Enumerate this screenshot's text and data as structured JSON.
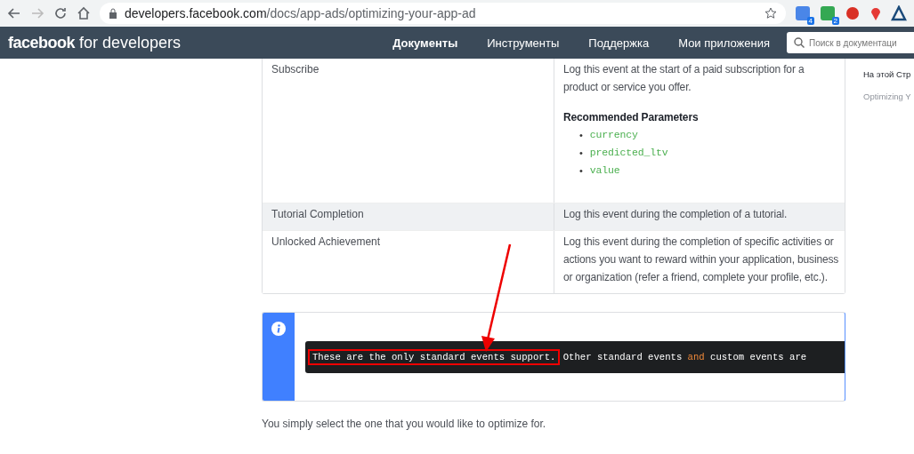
{
  "browser": {
    "url_host": "developers.facebook.com",
    "url_path": "/docs/app-ads/optimizing-your-app-ad",
    "extension_badges": [
      "4",
      "2"
    ]
  },
  "nav": {
    "logo_bold": "facebook",
    "logo_rest": "for developers",
    "links": [
      {
        "label": "Документы",
        "selected": true
      },
      {
        "label": "Инструменты",
        "selected": false
      },
      {
        "label": "Поддержка",
        "selected": false
      },
      {
        "label": "Мои приложения",
        "selected": false
      }
    ],
    "search": {
      "placeholder": "Поиск в документаци"
    }
  },
  "table": {
    "rows": [
      {
        "event": "Subscribe",
        "description": "Log this event at the start of a paid subscription for a product or service you offer.",
        "params_title": "Recommended Parameters",
        "params": [
          {
            "marker": "•",
            "name": "currency"
          },
          {
            "marker": "•",
            "name": "predicted_ltv"
          },
          {
            "marker": "•",
            "name": "value"
          }
        ],
        "shaded": false
      },
      {
        "event": "Tutorial Completion",
        "description": "Log this event during the completion of a tutorial.",
        "shaded": true
      },
      {
        "event": "Unlocked Achievement",
        "description": "Log this event during the completion of specific activities or actions you want to reward within your application, business or organization (refer a friend, complete your profile, etc.).",
        "shaded": false
      }
    ]
  },
  "notice": {
    "code": [
      {
        "text": "These are the only standard events support.",
        "kind": "plain",
        "highlighted": true
      },
      {
        "text": " Other standard events ",
        "kind": "plain",
        "highlighted": false
      },
      {
        "text": "and",
        "kind": "keyword",
        "highlighted": false
      },
      {
        "text": " custom events are",
        "kind": "plain",
        "highlighted": false
      }
    ]
  },
  "paragraph": "You simply select the one that you would like to optimize for.",
  "toc": {
    "title": "На этой Стр",
    "items": [
      "Optimizing Y"
    ]
  }
}
